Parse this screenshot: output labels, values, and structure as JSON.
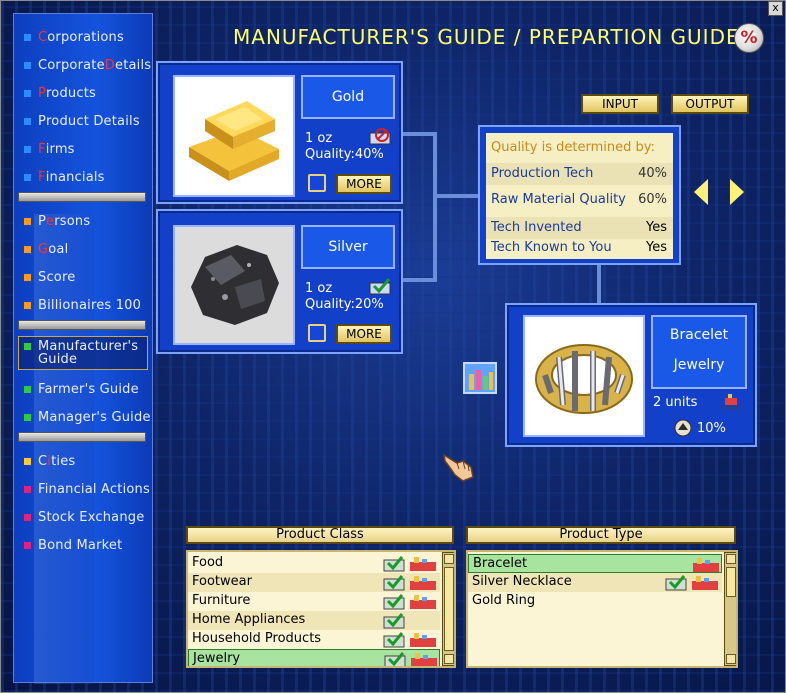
{
  "title": "MANUFACTURER'S GUIDE / PREPARTION GUIDE",
  "percent_symbol": "%",
  "close_symbol": "x",
  "sidebar": {
    "items": [
      {
        "first": "C",
        "rest": "orporations",
        "square": "#2a8cff"
      },
      {
        "first": "C",
        "rest": "orporate ",
        "red": "D",
        "tail": "etails",
        "square": "#2a8cff"
      },
      {
        "first": "P",
        "rest": "roducts",
        "square": "#2a8cff"
      },
      {
        "first": "P",
        "rest": "roduct Details",
        "square": "#2a8cff"
      },
      {
        "first": "F",
        "rest": "irms",
        "square": "#2a8cff"
      },
      {
        "first": "F",
        "rest": "inancials",
        "square": "#2a8cff"
      },
      {
        "first": "P",
        "rest": "ersons",
        "square": "#ff9a1a"
      },
      {
        "first": "G",
        "rest": "oal",
        "square": "#ff9a1a"
      },
      {
        "first": "S",
        "rest": "core",
        "square": "#ff9a1a"
      },
      {
        "first": "B",
        "rest": "illionaires 100",
        "square": "#ff9a1a"
      },
      {
        "label": "Manufacturer's Guide",
        "square": "#2ecc40"
      },
      {
        "label": "Farmer's Guide",
        "square": "#2ecc40"
      },
      {
        "label": "Manager's Guide",
        "square": "#2ecc40"
      },
      {
        "first": "C",
        "red": "i",
        "rest": "ties",
        "square": "#ffcc33"
      },
      {
        "label": "Financial Actions",
        "square": "#e8207a"
      },
      {
        "label": "Stock Exchange",
        "square": "#e8207a"
      },
      {
        "label": "Bond Market",
        "square": "#e8207a"
      }
    ]
  },
  "inputs": [
    {
      "name": "Gold",
      "qty": "1 oz",
      "quality": "Quality:40%",
      "more": "MORE"
    },
    {
      "name": "Silver",
      "qty": "1 oz",
      "quality": "Quality:20%",
      "more": "MORE"
    }
  ],
  "buttons": {
    "input": "INPUT",
    "output": "OUTPUT"
  },
  "quality_box": {
    "header": "Quality is determined by:",
    "rows": [
      {
        "label": "Production Tech",
        "value": "40%"
      },
      {
        "label": "Raw Material Quality",
        "value": "60%"
      },
      {
        "label": "Tech Invented",
        "value": "Yes"
      },
      {
        "label": "Tech Known to You",
        "value": "Yes"
      }
    ]
  },
  "output": {
    "name": "Bracelet",
    "category": "Jewelry",
    "units": "2 units",
    "percent": "10%"
  },
  "product_class": {
    "header": "Product Class",
    "items": [
      "Food",
      "Footwear",
      "Furniture",
      "Home Appliances",
      "Household Products",
      "Jewelry"
    ],
    "selected_index": 5
  },
  "product_type": {
    "header": "Product Type",
    "items": [
      "Bracelet",
      "Silver Necklace",
      "Gold Ring"
    ],
    "selected_index": 0
  },
  "colors": {
    "title": "#ffff66",
    "panel": "#1340c8",
    "accent_red": "#ff3030"
  }
}
